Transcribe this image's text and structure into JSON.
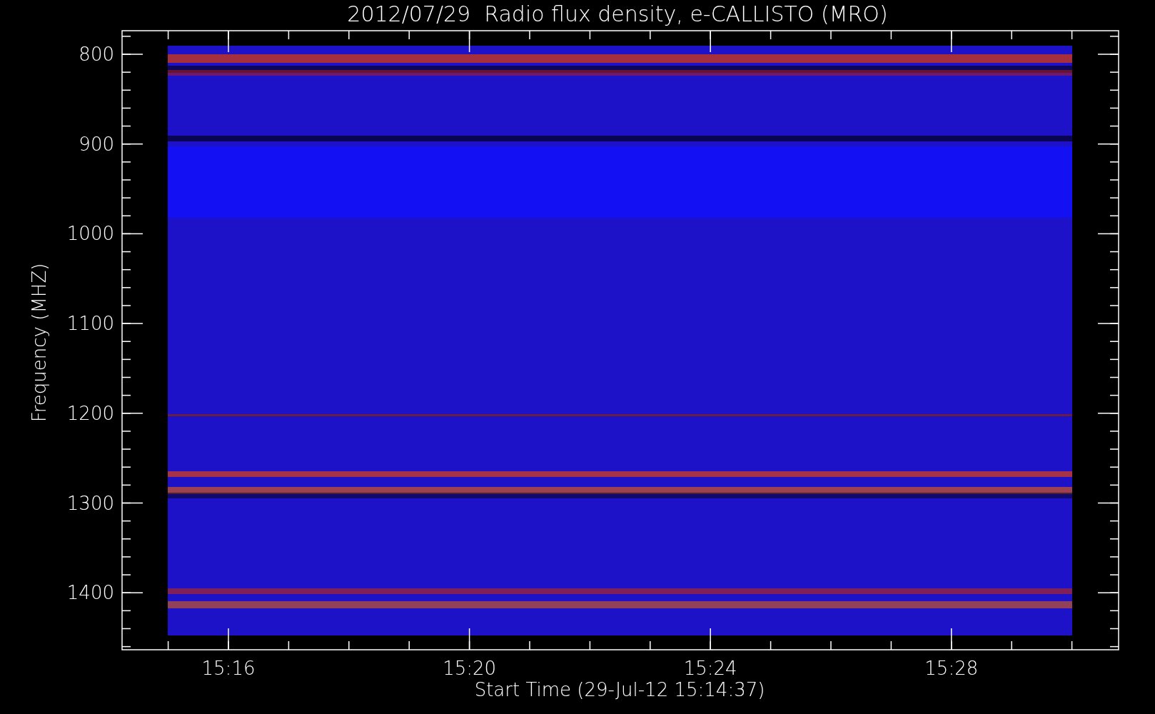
{
  "plot": {
    "title": "2012/07/29  Radio flux density, e-CALLISTO (MRO)",
    "ylabel": "Frequency (MHZ)",
    "xlabel": "Start Time (29-Jul-12 15:14:37)",
    "yticks": [
      "800",
      "900",
      "1000",
      "1100",
      "1200",
      "1300",
      "1400"
    ],
    "xticks": [
      "15:16",
      "15:20",
      "15:24",
      "15:28"
    ]
  }
}
